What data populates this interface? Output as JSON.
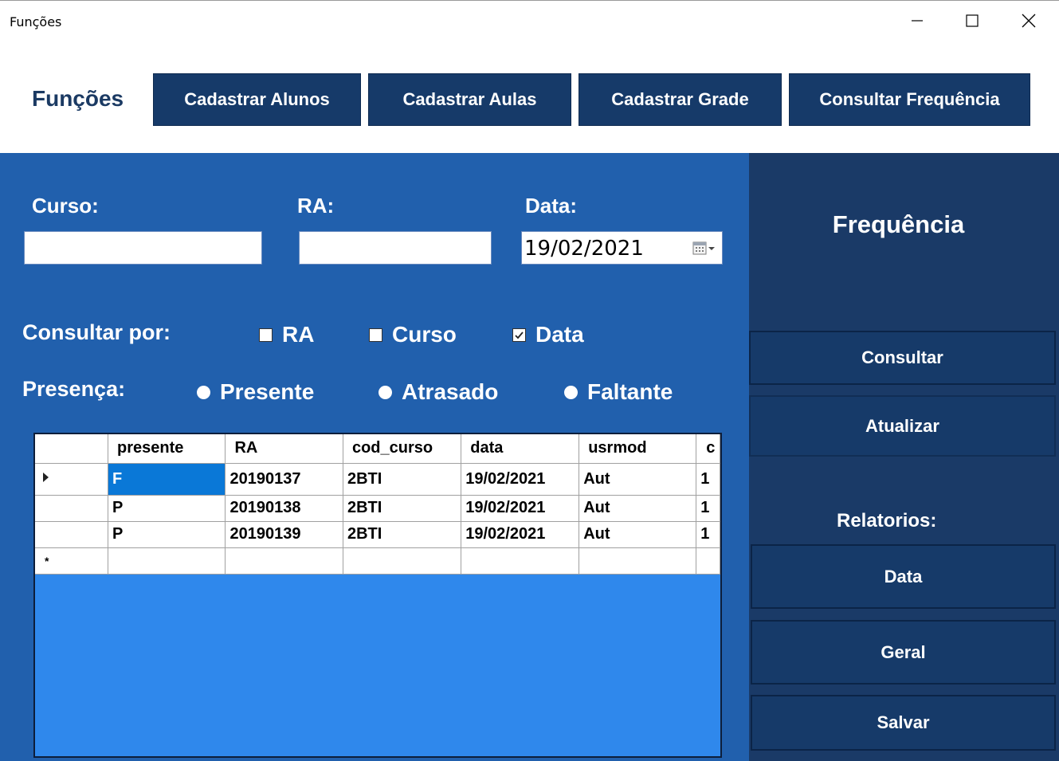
{
  "window": {
    "title": "Funções"
  },
  "header": {
    "brand": "Funções",
    "nav": [
      "Cadastrar Alunos",
      "Cadastrar Aulas",
      "Cadastrar Grade",
      "Consultar Frequência"
    ]
  },
  "form": {
    "curso_label": "Curso:",
    "ra_label": "RA:",
    "data_label": "Data:",
    "curso_value": "",
    "ra_value": "",
    "data_value": "19/02/2021",
    "consultar_label": "Consultar por:",
    "checkboxes": [
      {
        "label": "RA",
        "checked": false
      },
      {
        "label": "Curso",
        "checked": false
      },
      {
        "label": "Data",
        "checked": true
      }
    ],
    "presenca_label": "Presença:",
    "radios": [
      "Presente",
      "Atrasado",
      "Faltante"
    ]
  },
  "grid": {
    "columns": [
      "presente",
      "RA",
      "cod_curso",
      "data",
      "usrmod",
      "c"
    ],
    "rows": [
      [
        "F",
        "20190137",
        "2BTI",
        "19/02/2021",
        "Aut",
        "1"
      ],
      [
        "P",
        "20190138",
        "2BTI",
        "19/02/2021",
        "Aut",
        "1"
      ],
      [
        "P",
        "20190139",
        "2BTI",
        "19/02/2021",
        "Aut",
        "1"
      ]
    ],
    "new_row_marker": "*"
  },
  "side": {
    "heading": "Frequência",
    "consultar": "Consultar",
    "atualizar": "Atualizar",
    "relatorios_label": "Relatorios:",
    "data": "Data",
    "geral": "Geral",
    "salvar": "Salvar"
  },
  "colors": {
    "dark_blue": "#163a69",
    "panel_blue": "#2160ad",
    "grid_bg": "#2f88ec",
    "selection": "#0a78d7"
  }
}
